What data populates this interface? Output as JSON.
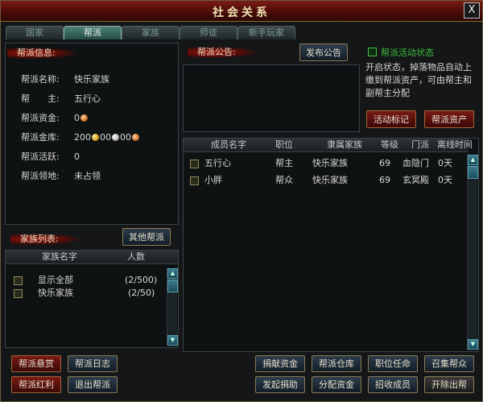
{
  "window": {
    "title": "社会关系",
    "close": "X"
  },
  "tabs": [
    {
      "label": "国家",
      "active": false
    },
    {
      "label": "帮派",
      "active": true
    },
    {
      "label": "家族",
      "active": false
    },
    {
      "label": "师徒",
      "active": false
    },
    {
      "label": "新手玩家",
      "active": false
    }
  ],
  "guild_info": {
    "header": "帮派信息:",
    "name_label": "帮派名称:",
    "name_value": "快乐家族",
    "leader_label": "帮　　主:",
    "leader_value": "五行心",
    "funds_label": "帮派资金:",
    "funds_value": "0",
    "vault_label": "帮派金库:",
    "vault_gold": "200",
    "vault_silver": "00",
    "vault_copper": "00",
    "activity_label": "帮派活跃:",
    "activity_value": "0",
    "territory_label": "帮派领地:",
    "territory_value": "未占领"
  },
  "notice": {
    "header": "帮派公告:",
    "publish_button": "发布公告"
  },
  "activity_state": {
    "checkbox_label": "帮派活动状态",
    "description": "开启状态，掉落物品自动上缴到帮派资产，可由帮主和副帮主分配",
    "mark_button": "活动标记",
    "assets_button": "帮派资产"
  },
  "families": {
    "header": "家族列表:",
    "other_guilds_button": "其他帮派",
    "columns": [
      "家族名字",
      "人数"
    ],
    "rows": [
      {
        "name": "显示全部",
        "count": "(2/500)"
      },
      {
        "name": "快乐家族",
        "count": "(2/50)"
      }
    ]
  },
  "members": {
    "columns": [
      "成员名字",
      "职位",
      "隶属家族",
      "等级",
      "门派",
      "离线时间"
    ],
    "rows": [
      {
        "name": "五行心",
        "role": "帮主",
        "family": "快乐家族",
        "level": "69",
        "sect": "血隐门",
        "offline": "0天"
      },
      {
        "name": "小胖",
        "role": "帮众",
        "family": "快乐家族",
        "level": "69",
        "sect": "玄冥殿",
        "offline": "0天"
      }
    ]
  },
  "bottom_buttons": {
    "bounty": "帮派悬赏",
    "log": "帮派日志",
    "bonus": "帮派红利",
    "quit": "退出帮派",
    "donate_funds": "捐献资金",
    "warehouse": "帮派仓库",
    "appoint": "职位任命",
    "summon": "召集帮众",
    "start_donation": "发起捐助",
    "distribute": "分配资金",
    "recruit": "招收成员",
    "expel": "开除出帮"
  },
  "colors": {
    "accent_red": "#7a1a14",
    "tab_active": "#4e8278",
    "checkbox_green": "#3ec03e",
    "text": "#d8d8d8"
  }
}
